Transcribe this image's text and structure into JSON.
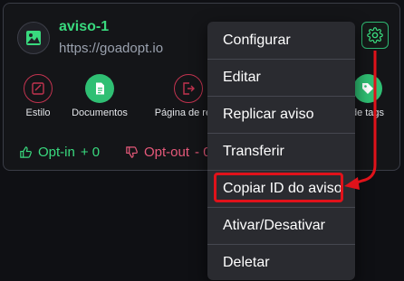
{
  "card": {
    "title": "aviso-1",
    "url": "https://goadopt.io",
    "actions": [
      {
        "label": "Estilo",
        "icon": "edit-box-icon"
      },
      {
        "label": "Documentos",
        "icon": "document-icon"
      },
      {
        "label": "Página de requ",
        "icon": "logout-icon"
      },
      {
        "label": "de tags",
        "icon": "tag-icon"
      }
    ],
    "opt_in": {
      "label": "Opt-in",
      "count": "+ 0"
    },
    "opt_out": {
      "label": "Opt-out",
      "count": "- 0"
    }
  },
  "menu": {
    "items": [
      {
        "label": "Configurar"
      },
      {
        "label": "Editar"
      },
      {
        "label": "Replicar aviso"
      },
      {
        "label": "Transferir"
      },
      {
        "label": "Copiar ID do aviso"
      },
      {
        "label": "Ativar/Desativar"
      },
      {
        "label": "Deletar"
      }
    ]
  },
  "colors": {
    "accent_green": "#39d97e",
    "accent_red": "#e6597a",
    "annotation_red": "#e0121a",
    "menu_bg": "#2a2b30"
  }
}
